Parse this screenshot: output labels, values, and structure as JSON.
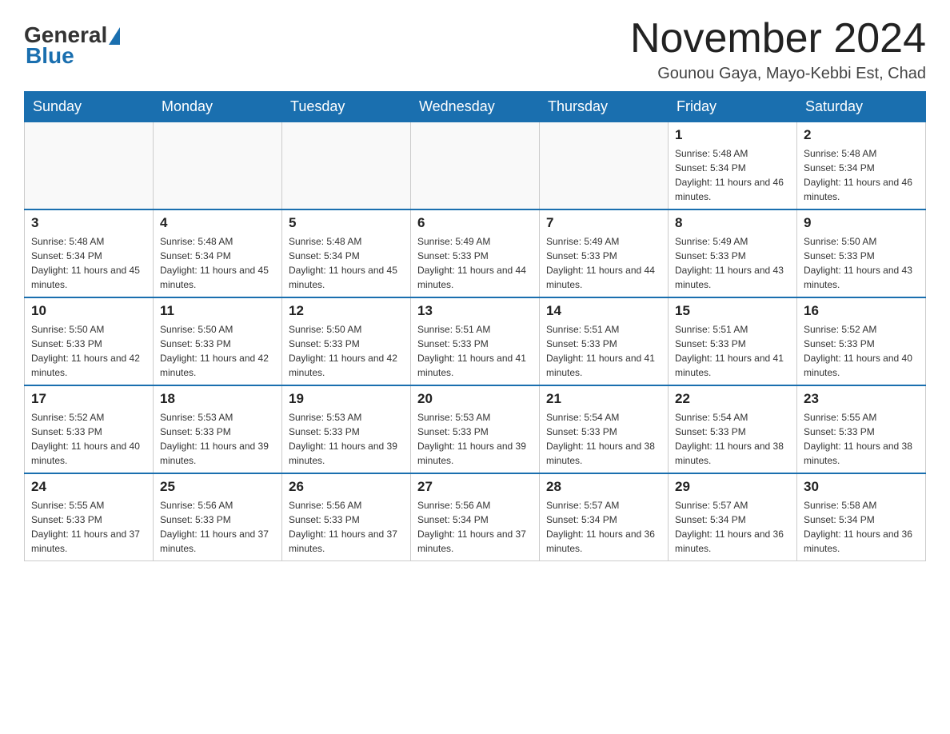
{
  "logo": {
    "general": "General",
    "blue": "Blue"
  },
  "header": {
    "month_title": "November 2024",
    "subtitle": "Gounou Gaya, Mayo-Kebbi Est, Chad"
  },
  "days_of_week": [
    "Sunday",
    "Monday",
    "Tuesday",
    "Wednesday",
    "Thursday",
    "Friday",
    "Saturday"
  ],
  "weeks": [
    [
      {
        "day": "",
        "info": ""
      },
      {
        "day": "",
        "info": ""
      },
      {
        "day": "",
        "info": ""
      },
      {
        "day": "",
        "info": ""
      },
      {
        "day": "",
        "info": ""
      },
      {
        "day": "1",
        "info": "Sunrise: 5:48 AM\nSunset: 5:34 PM\nDaylight: 11 hours and 46 minutes."
      },
      {
        "day": "2",
        "info": "Sunrise: 5:48 AM\nSunset: 5:34 PM\nDaylight: 11 hours and 46 minutes."
      }
    ],
    [
      {
        "day": "3",
        "info": "Sunrise: 5:48 AM\nSunset: 5:34 PM\nDaylight: 11 hours and 45 minutes."
      },
      {
        "day": "4",
        "info": "Sunrise: 5:48 AM\nSunset: 5:34 PM\nDaylight: 11 hours and 45 minutes."
      },
      {
        "day": "5",
        "info": "Sunrise: 5:48 AM\nSunset: 5:34 PM\nDaylight: 11 hours and 45 minutes."
      },
      {
        "day": "6",
        "info": "Sunrise: 5:49 AM\nSunset: 5:33 PM\nDaylight: 11 hours and 44 minutes."
      },
      {
        "day": "7",
        "info": "Sunrise: 5:49 AM\nSunset: 5:33 PM\nDaylight: 11 hours and 44 minutes."
      },
      {
        "day": "8",
        "info": "Sunrise: 5:49 AM\nSunset: 5:33 PM\nDaylight: 11 hours and 43 minutes."
      },
      {
        "day": "9",
        "info": "Sunrise: 5:50 AM\nSunset: 5:33 PM\nDaylight: 11 hours and 43 minutes."
      }
    ],
    [
      {
        "day": "10",
        "info": "Sunrise: 5:50 AM\nSunset: 5:33 PM\nDaylight: 11 hours and 42 minutes."
      },
      {
        "day": "11",
        "info": "Sunrise: 5:50 AM\nSunset: 5:33 PM\nDaylight: 11 hours and 42 minutes."
      },
      {
        "day": "12",
        "info": "Sunrise: 5:50 AM\nSunset: 5:33 PM\nDaylight: 11 hours and 42 minutes."
      },
      {
        "day": "13",
        "info": "Sunrise: 5:51 AM\nSunset: 5:33 PM\nDaylight: 11 hours and 41 minutes."
      },
      {
        "day": "14",
        "info": "Sunrise: 5:51 AM\nSunset: 5:33 PM\nDaylight: 11 hours and 41 minutes."
      },
      {
        "day": "15",
        "info": "Sunrise: 5:51 AM\nSunset: 5:33 PM\nDaylight: 11 hours and 41 minutes."
      },
      {
        "day": "16",
        "info": "Sunrise: 5:52 AM\nSunset: 5:33 PM\nDaylight: 11 hours and 40 minutes."
      }
    ],
    [
      {
        "day": "17",
        "info": "Sunrise: 5:52 AM\nSunset: 5:33 PM\nDaylight: 11 hours and 40 minutes."
      },
      {
        "day": "18",
        "info": "Sunrise: 5:53 AM\nSunset: 5:33 PM\nDaylight: 11 hours and 39 minutes."
      },
      {
        "day": "19",
        "info": "Sunrise: 5:53 AM\nSunset: 5:33 PM\nDaylight: 11 hours and 39 minutes."
      },
      {
        "day": "20",
        "info": "Sunrise: 5:53 AM\nSunset: 5:33 PM\nDaylight: 11 hours and 39 minutes."
      },
      {
        "day": "21",
        "info": "Sunrise: 5:54 AM\nSunset: 5:33 PM\nDaylight: 11 hours and 38 minutes."
      },
      {
        "day": "22",
        "info": "Sunrise: 5:54 AM\nSunset: 5:33 PM\nDaylight: 11 hours and 38 minutes."
      },
      {
        "day": "23",
        "info": "Sunrise: 5:55 AM\nSunset: 5:33 PM\nDaylight: 11 hours and 38 minutes."
      }
    ],
    [
      {
        "day": "24",
        "info": "Sunrise: 5:55 AM\nSunset: 5:33 PM\nDaylight: 11 hours and 37 minutes."
      },
      {
        "day": "25",
        "info": "Sunrise: 5:56 AM\nSunset: 5:33 PM\nDaylight: 11 hours and 37 minutes."
      },
      {
        "day": "26",
        "info": "Sunrise: 5:56 AM\nSunset: 5:33 PM\nDaylight: 11 hours and 37 minutes."
      },
      {
        "day": "27",
        "info": "Sunrise: 5:56 AM\nSunset: 5:34 PM\nDaylight: 11 hours and 37 minutes."
      },
      {
        "day": "28",
        "info": "Sunrise: 5:57 AM\nSunset: 5:34 PM\nDaylight: 11 hours and 36 minutes."
      },
      {
        "day": "29",
        "info": "Sunrise: 5:57 AM\nSunset: 5:34 PM\nDaylight: 11 hours and 36 minutes."
      },
      {
        "day": "30",
        "info": "Sunrise: 5:58 AM\nSunset: 5:34 PM\nDaylight: 11 hours and 36 minutes."
      }
    ]
  ]
}
